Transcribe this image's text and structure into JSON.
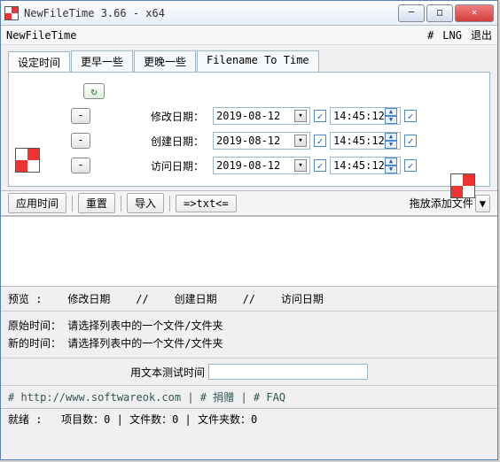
{
  "window": {
    "title": "NewFileTime 3.66 - x64"
  },
  "menubar": {
    "app": "NewFileTime",
    "hash": "#",
    "lng": "LNG",
    "exit": "退出"
  },
  "tabs": {
    "t0": "设定时间",
    "t1": "更早一些",
    "t2": "更晚一些",
    "t3": "Filename To Time"
  },
  "rows": {
    "modify": {
      "label": "修改日期：",
      "date": "2019-08-12",
      "time": "14:45:12"
    },
    "create": {
      "label": "创建日期：",
      "date": "2019-08-12",
      "time": "14:45:12"
    },
    "access": {
      "label": "访问日期：",
      "date": "2019-08-12",
      "time": "14:45:12"
    },
    "minus": "-"
  },
  "toolbar": {
    "apply": "应用时间",
    "reset": "重置",
    "import": "导入",
    "txt": "=>txt<=",
    "drag": "拖放添加文件",
    "drop": "▼"
  },
  "preview": {
    "label": "预览 :",
    "m": "修改日期",
    "c": "创建日期",
    "a": "访问日期",
    "sep": "//"
  },
  "info": {
    "orig_lbl": "原始时间：",
    "orig_val": "请选择列表中的一个文件/文件夹",
    "new_lbl": "新的时间：",
    "new_val": "请选择列表中的一个文件/文件夹"
  },
  "test": {
    "label": "用文本测试时间"
  },
  "links": {
    "url": "# http://www.softwareok.com",
    "donate": "# 捐赠",
    "faq": "# FAQ",
    "sep": " | "
  },
  "status": {
    "ready": "就绪 :",
    "items": "项目数：0",
    "files": "文件数：0",
    "folders": "文件夹数：0",
    "sep": " | "
  }
}
